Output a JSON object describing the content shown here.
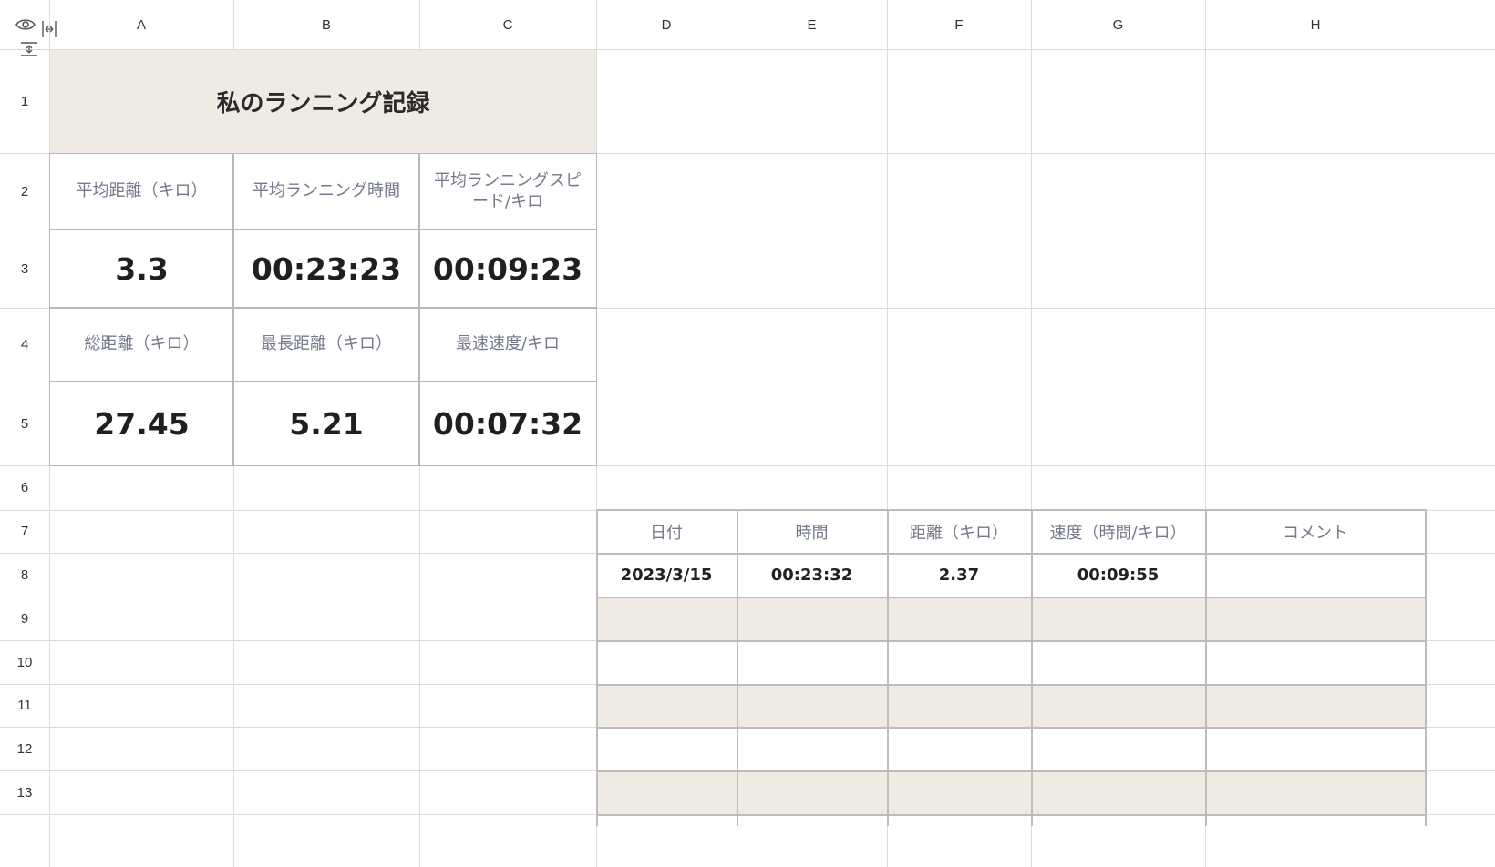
{
  "columns": [
    "A",
    "B",
    "C",
    "D",
    "E",
    "F",
    "G",
    "H"
  ],
  "rows": [
    "1",
    "2",
    "3",
    "4",
    "5",
    "6",
    "7",
    "8",
    "9",
    "10",
    "11",
    "12",
    "13"
  ],
  "dashboard": {
    "title": "私のランニング記録",
    "avg_distance_label": "平均距離（キロ）",
    "avg_time_label": "平均ランニング時間",
    "avg_speed_label": "平均ランニングスピード/キロ",
    "avg_distance_value": "3.3",
    "avg_time_value": "00:23:23",
    "avg_speed_value": "00:09:23",
    "total_distance_label": "総距離（キロ）",
    "longest_distance_label": "最長距離（キロ）",
    "fastest_speed_label": "最速速度/キロ",
    "total_distance_value": "27.45",
    "longest_distance_value": "5.21",
    "fastest_speed_value": "00:07:32"
  },
  "log_table": {
    "headers": [
      "日付",
      "時間",
      "距離（キロ）",
      "速度（時間/キロ）",
      "コメント"
    ],
    "rows": [
      [
        "2023/3/15",
        "00:23:32",
        "2.37",
        "00:09:55",
        ""
      ]
    ]
  },
  "icons": {
    "eye": "eye-icon",
    "column_resize": "column-resize-icon",
    "row_resize": "row-resize-icon"
  },
  "colors": {
    "band": "#efebe3",
    "label_text": "#757a8a",
    "grid": "#dcdcdc"
  }
}
